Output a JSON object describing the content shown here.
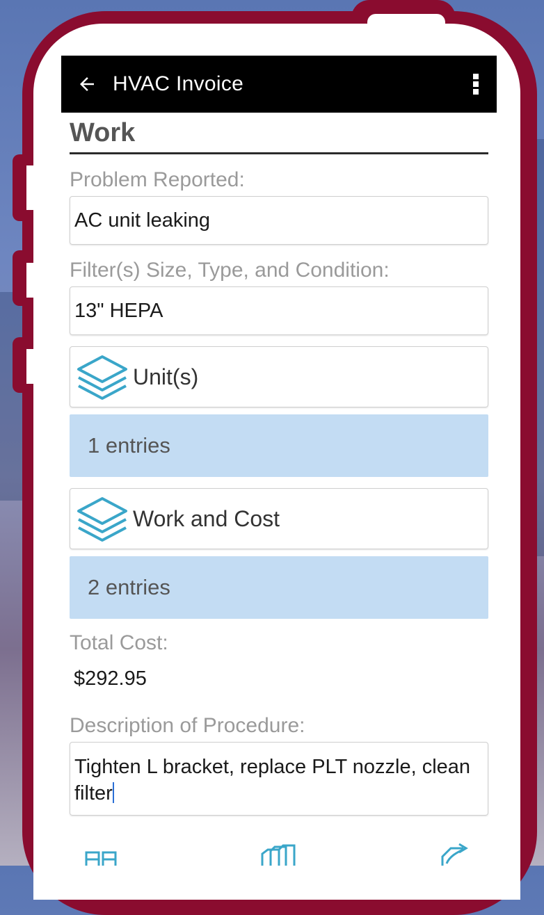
{
  "appbar": {
    "title": "HVAC Invoice",
    "back_icon": "arrow-left-icon",
    "menu_icon": "more-vertical-icon"
  },
  "section": {
    "title": "Work"
  },
  "problem": {
    "label": "Problem Reported:",
    "value": "AC unit leaking"
  },
  "filter": {
    "label": "Filter(s) Size, Type, and Condition:",
    "value": "13\" HEPA"
  },
  "units": {
    "label": "Unit(s)",
    "icon": "layers-icon",
    "entries": "1 entries"
  },
  "work_cost": {
    "label": "Work and Cost",
    "icon": "layers-icon",
    "entries": "2 entries"
  },
  "total": {
    "label": "Total Cost:",
    "value": "$292.95"
  },
  "procedure": {
    "label": "Description of Procedure:",
    "value": "Tighten L bracket, replace PLT nozzle, clean filter"
  },
  "colors": {
    "phone_frame": "#8a0c2f",
    "appbar": "#000000",
    "entries_bg": "#c3dcf3",
    "icon_accent": "#3aa6c9"
  }
}
